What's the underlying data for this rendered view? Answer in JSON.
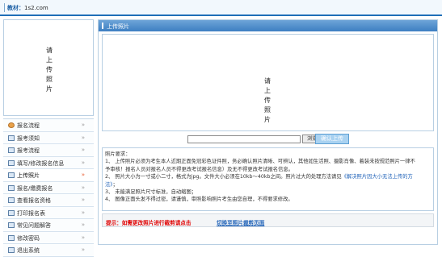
{
  "header": {
    "site_label": "教材：",
    "site_url": "1s2.com"
  },
  "sidebar": {
    "photo_placeholder": "请上传照片",
    "items": [
      {
        "label": "报名流程",
        "icon": "gear-icon",
        "active": false
      },
      {
        "label": "报考须知",
        "icon": "doc-icon",
        "active": false
      },
      {
        "label": "报考流程",
        "icon": "doc-icon",
        "active": false
      },
      {
        "label": "填写/修改报名信息",
        "icon": "doc-icon",
        "active": false
      },
      {
        "label": "上传照片",
        "icon": "doc-icon",
        "active": true
      },
      {
        "label": "报名/缴费报名",
        "icon": "doc-icon",
        "active": false
      },
      {
        "label": "查看报名资格",
        "icon": "doc-icon",
        "active": false
      },
      {
        "label": "打印报名表",
        "icon": "doc-icon",
        "active": false
      },
      {
        "label": "常见问题解答",
        "icon": "doc-icon",
        "active": false
      },
      {
        "label": "修改密码",
        "icon": "doc-icon",
        "active": false
      },
      {
        "label": "退出系统",
        "icon": "doc-icon",
        "active": false
      }
    ],
    "arrow": "»"
  },
  "main": {
    "title": "上传照片",
    "preview_placeholder": "请上传照片",
    "upload": {
      "browse_label": "浏览...",
      "submit_label": "确认上传"
    },
    "tips": {
      "heading": "照片要求：",
      "line1": "1、 上传照片必须为考生本人近期正面免冠彩色证件照，务必确认照片清晰、可辨认，其他如生活照、摄影肖像、着装未按规范照片一律不",
      "line1b": "予审核！报名人员对报名人员不得更改考试报名信息）及无不得更改考试报名信息。",
      "line2a": "2、 照片大小为一寸或小二寸，格式为jpg。文件大小必须在10kb～40kb之间。照片过大的处理方法请见",
      "line2_link": "《解决照片因大小无法上传的方",
      "line2b_link": "法》",
      "line2c": "；",
      "line3": "3、 未能满足照片尺寸标准，自动缩图；",
      "line4": "4、 图像正面头发不得过密，请谨慎，审照影响照片考生由您自理，不得要求修改。"
    },
    "bottom": {
      "hint": "提示：如需更改照片进行截剪请点击",
      "link": "切换至照片裁剪页面"
    }
  }
}
